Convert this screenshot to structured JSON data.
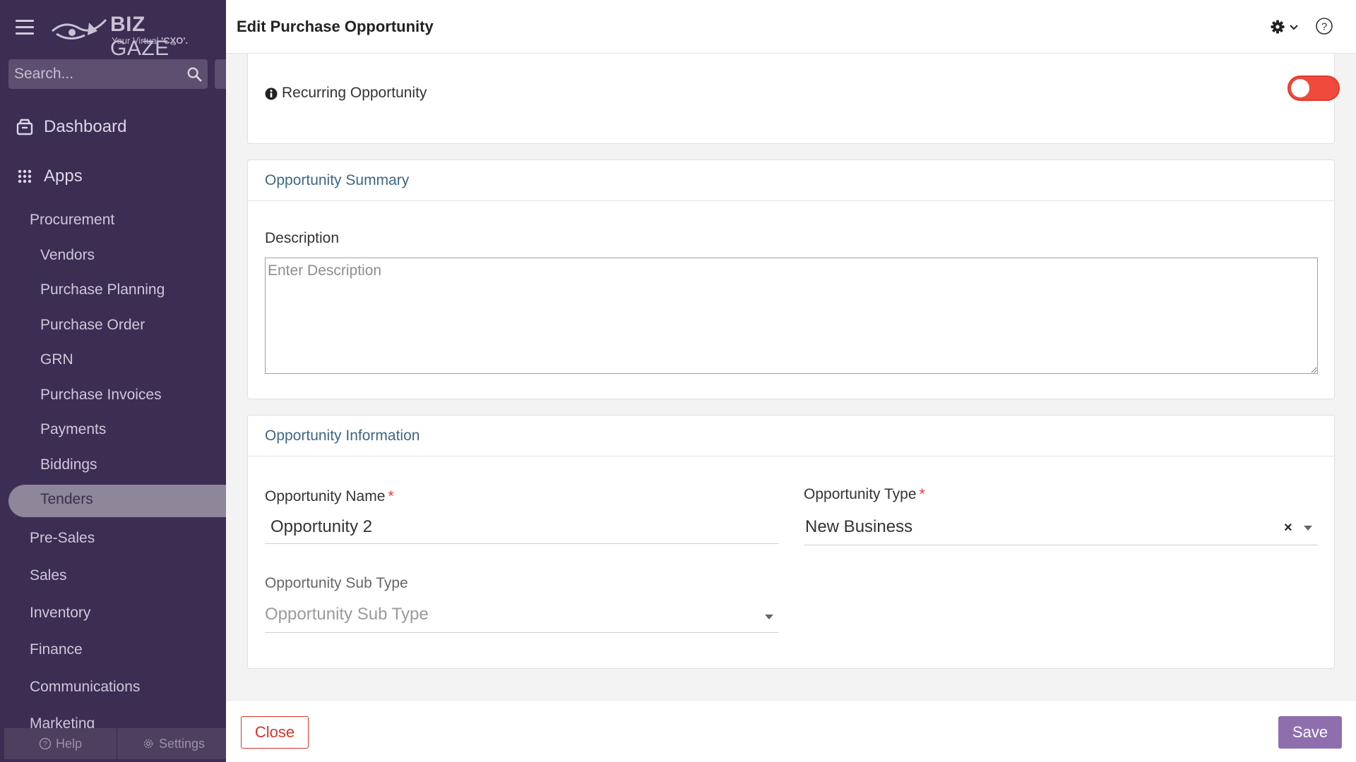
{
  "sidebar": {
    "logo_brand_bold": "BIZ",
    "logo_brand_light": " GAZE",
    "logo_tm": "™",
    "logo_tagline": "Your Virtual ",
    "logo_tagline_bold": "'CXO'.",
    "search_placeholder": "Search...",
    "dashboard_label": "Dashboard",
    "apps_label": "Apps",
    "group_procurement": "Procurement",
    "procurement_items": [
      "Vendors",
      "Purchase Planning",
      "Purchase Order",
      "GRN",
      "Purchase Invoices",
      "Payments",
      "Biddings",
      "Tenders"
    ],
    "active_item": "Tenders",
    "other_groups": [
      "Pre-Sales",
      "Sales",
      "Inventory",
      "Finance",
      "Communications",
      "Marketing"
    ],
    "help_label": "Help",
    "settings_label": "Settings"
  },
  "header": {
    "title": "Edit Purchase Opportunity",
    "icons": [
      "gear-icon",
      "chevron-down-icon",
      "help-circle-icon"
    ]
  },
  "recurring": {
    "label": "Recurring Opportunity",
    "toggle_on": false,
    "toggle_color": "#ef4a3c"
  },
  "summary": {
    "heading": "Opportunity Summary",
    "description_label": "Description",
    "description_placeholder": "Enter Description",
    "description_value": ""
  },
  "information": {
    "heading": "Opportunity Information",
    "name_label": "Opportunity Name",
    "name_value": "Opportunity 2",
    "type_label": "Opportunity Type",
    "type_value": "New Business",
    "subtype_label": "Opportunity Sub Type",
    "subtype_placeholder": "Opportunity Sub Type",
    "required_mark": "*"
  },
  "footer": {
    "close_label": "Close",
    "save_label": "Save"
  },
  "colors": {
    "sidebar_bg": "#3c2d52",
    "accent": "#8f6eae",
    "danger": "#d9322a",
    "section_heading": "#3e6785"
  }
}
